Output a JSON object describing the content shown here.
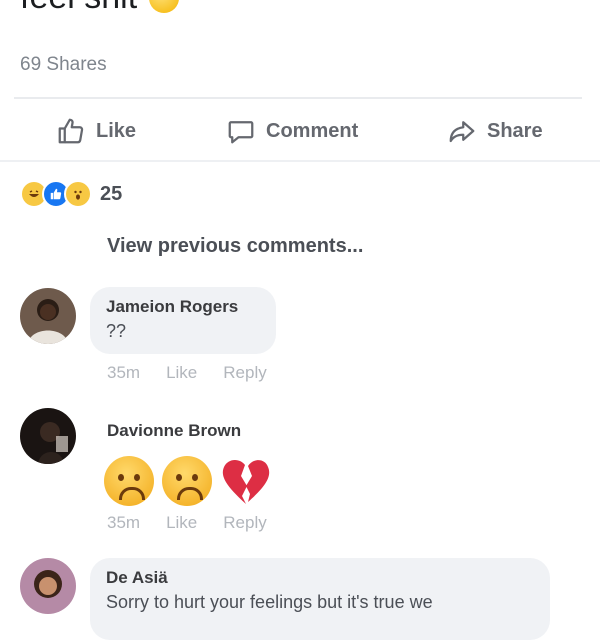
{
  "post": {
    "text_fragment": "feel shit",
    "shares": "69 Shares"
  },
  "actions": {
    "like": "Like",
    "comment": "Comment",
    "share": "Share"
  },
  "reactions": {
    "types": [
      "haha",
      "like",
      "wow"
    ],
    "count": "25"
  },
  "view_previous": "View previous comments...",
  "comments": [
    {
      "author": "Jameion Rogers",
      "text": "??",
      "time": "35m",
      "like": "Like",
      "reply": "Reply"
    },
    {
      "author": "Davionne Brown",
      "emojis": [
        "sad-face",
        "sad-face",
        "broken-heart"
      ],
      "time": "35m",
      "like": "Like",
      "reply": "Reply"
    },
    {
      "author": "De Asiä",
      "text": "Sorry to hurt your feelings but it's true we"
    }
  ],
  "colors": {
    "accent": "#1877f2",
    "bubble": "#f0f2f5",
    "muted": "#b2b6bc"
  }
}
